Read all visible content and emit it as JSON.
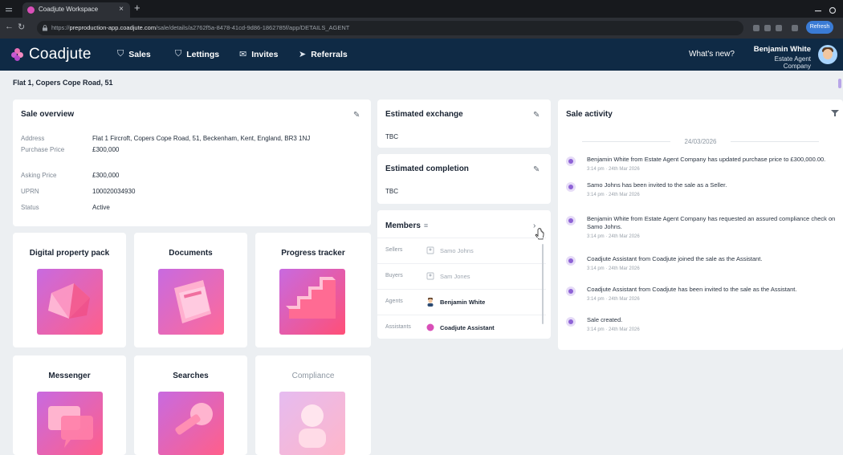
{
  "browser": {
    "tab_title": "Coadjute Workspace",
    "tab_close": "×",
    "new_tab": "+",
    "url_host": "preproduction-app.coadjute.com",
    "url_path": "/sale/details/a2762f5a-8478-41cd-9d86-1862785f/app/DETAILS_AGENT",
    "url_scheme": "https://",
    "profile_label": "Refresh"
  },
  "nav": {
    "brand": "Coadjute",
    "links": [
      {
        "label": "Sales",
        "icon": "tag-icon",
        "glyph": "⛉"
      },
      {
        "label": "Lettings",
        "icon": "key-icon",
        "glyph": "⛉"
      },
      {
        "label": "Invites",
        "icon": "envelope-icon",
        "glyph": "✉"
      },
      {
        "label": "Referrals",
        "icon": "send-icon",
        "glyph": "➤"
      }
    ],
    "whats_new": "What's new?",
    "user_name": "Benjamin White",
    "user_company": "Estate Agent Company"
  },
  "breadcrumb": "Flat 1, Copers Cope Road, 51",
  "sale_overview": {
    "title": "Sale overview",
    "rows": [
      {
        "label": "Address",
        "value": "Flat 1 Fircroft, Copers Cope Road, 51, Beckenham, Kent, England, BR3 1NJ"
      },
      {
        "label": "Purchase Price",
        "value": "£300,000"
      },
      {
        "label": "Asking Price",
        "value": "£300,000"
      },
      {
        "label": "UPRN",
        "value": "100020034930"
      },
      {
        "label": "Status",
        "value": "Active"
      }
    ]
  },
  "tiles": [
    {
      "title": "Digital property pack",
      "muted": false
    },
    {
      "title": "Documents",
      "muted": false
    },
    {
      "title": "Progress tracker",
      "muted": false
    },
    {
      "title": "Messenger",
      "muted": false
    },
    {
      "title": "Searches",
      "muted": false
    },
    {
      "title": "Compliance",
      "muted": true
    }
  ],
  "estimated_exchange": {
    "title": "Estimated exchange",
    "value": "TBC"
  },
  "estimated_completion": {
    "title": "Estimated completion",
    "value": "TBC"
  },
  "members": {
    "title": "Members",
    "title_suffix": "≡",
    "rows": [
      {
        "role": "Sellers",
        "name": "Samo Johns",
        "strong": false
      },
      {
        "role": "Buyers",
        "name": "Sam Jones",
        "strong": false
      },
      {
        "role": "Agents",
        "name": "Benjamin White",
        "strong": true
      },
      {
        "role": "Assistants",
        "name": "Coadjute Assistant",
        "strong": true
      }
    ]
  },
  "sale_activity": {
    "title": "Sale activity",
    "date": "24/03/2026",
    "items": [
      {
        "text": "Benjamin White from Estate Agent Company has updated purchase price to £300,000.00.",
        "time": "3:14 pm · 24th Mar 2026"
      },
      {
        "text": "Samo Johns has been invited to the sale as a Seller.",
        "time": "3:14 pm · 24th Mar 2026"
      },
      {
        "text": "Benjamin White from Estate Agent Company has requested an assured compliance check on Samo Johns.",
        "time": "3:14 pm · 24th Mar 2026"
      },
      {
        "text": "Coadjute Assistant from Coadjute joined the sale as the Assistant.",
        "time": "3:14 pm · 24th Mar 2026"
      },
      {
        "text": "Coadjute Assistant from Coadjute has been invited to the sale as the Assistant.",
        "time": "3:14 pm · 24th Mar 2026"
      },
      {
        "text": "Sale created.",
        "time": "3:14 pm · 24th Mar 2026"
      }
    ]
  }
}
